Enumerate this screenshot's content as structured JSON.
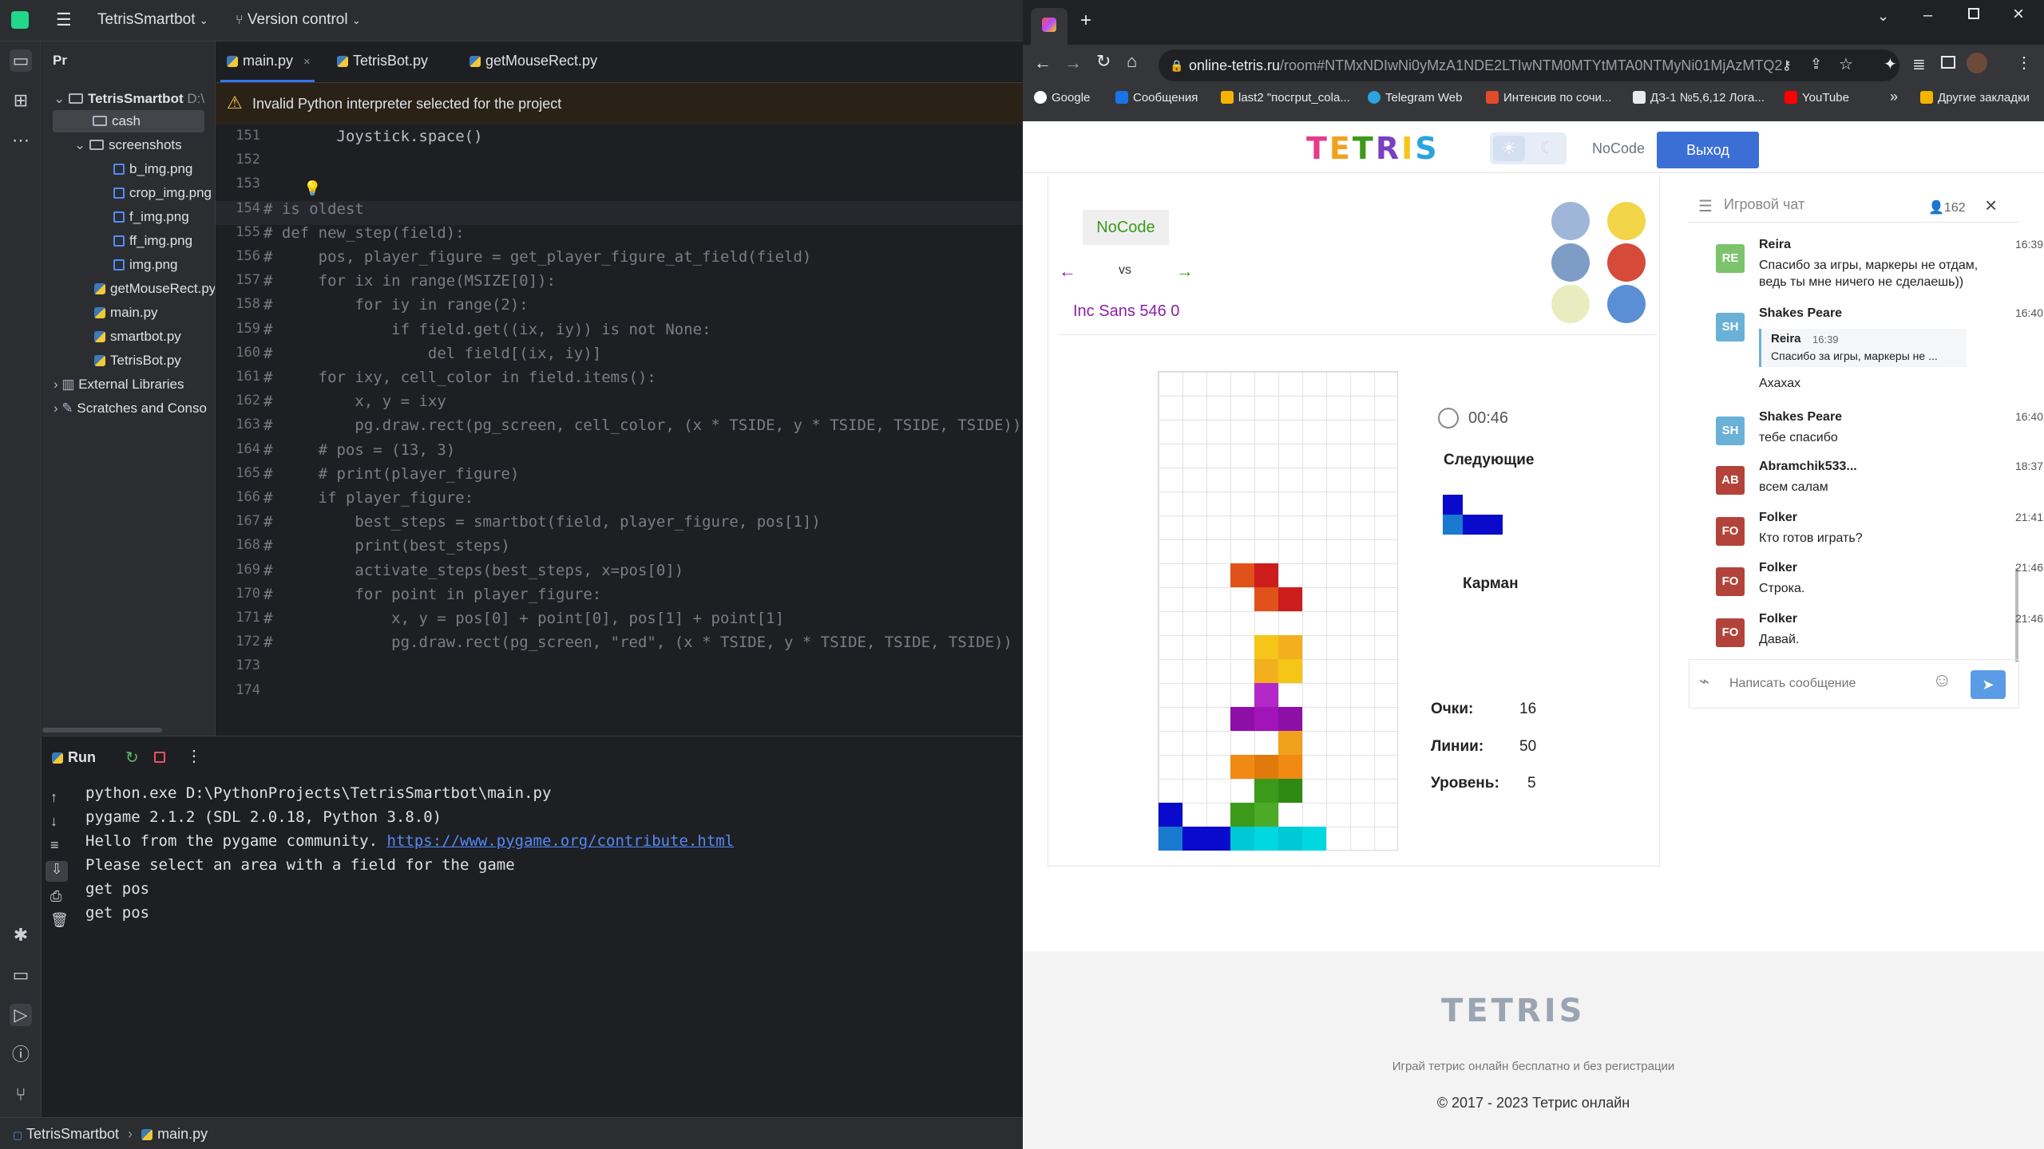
{
  "ide": {
    "project_name": "TetrisSmartbot",
    "version_control": "Version control",
    "panel_label": "Pr",
    "tree": {
      "root": "TetrisSmartbot",
      "root_path": "D:\\",
      "cash": "cash",
      "screenshots": "screenshots",
      "files_png": [
        "b_img.png",
        "crop_img.png",
        "f_img.png",
        "ff_img.png",
        "img.png"
      ],
      "files_py": [
        "getMouseRect.py",
        "main.py",
        "smartbot.py",
        "TetrisBot.py"
      ],
      "external": "External Libraries",
      "scratches": "Scratches and Conso"
    },
    "tabs": [
      "main.py",
      "TetrisBot.py",
      "getMouseRect.py"
    ],
    "warning": "Invalid Python interpreter selected for the project",
    "code_lines": [
      {
        "n": "151",
        "t": "        Joystick.space()"
      },
      {
        "n": "152",
        "t": ""
      },
      {
        "n": "153",
        "t": ""
      },
      {
        "n": "154",
        "t": "# is oldest"
      },
      {
        "n": "155",
        "t": "# def new_step(field):"
      },
      {
        "n": "156",
        "t": "#     pos, player_figure = get_player_figure_at_field(field)"
      },
      {
        "n": "157",
        "t": "#     for ix in range(MSIZE[0]):"
      },
      {
        "n": "158",
        "t": "#         for iy in range(2):"
      },
      {
        "n": "159",
        "t": "#             if field.get((ix, iy)) is not None:"
      },
      {
        "n": "160",
        "t": "#                 del field[(ix, iy)]"
      },
      {
        "n": "161",
        "t": "#     for ixy, cell_color in field.items():"
      },
      {
        "n": "162",
        "t": "#         x, y = ixy"
      },
      {
        "n": "163",
        "t": "#         pg.draw.rect(pg_screen, cell_color, (x * TSIDE, y * TSIDE, TSIDE, TSIDE))"
      },
      {
        "n": "164",
        "t": "#     # pos = (13, 3)"
      },
      {
        "n": "165",
        "t": "#     # print(player_figure)"
      },
      {
        "n": "166",
        "t": "#     if player_figure:"
      },
      {
        "n": "167",
        "t": "#         best_steps = smartbot(field, player_figure, pos[1])"
      },
      {
        "n": "168",
        "t": "#         print(best_steps)"
      },
      {
        "n": "169",
        "t": "#         activate_steps(best_steps, x=pos[0])"
      },
      {
        "n": "170",
        "t": "#         for point in player_figure:"
      },
      {
        "n": "171",
        "t": "#             x, y = pos[0] + point[0], pos[1] + point[1]"
      },
      {
        "n": "172",
        "t": "#             pg.draw.rect(pg_screen, \"red\", (x * TSIDE, y * TSIDE, TSIDE, TSIDE))"
      },
      {
        "n": "173",
        "t": ""
      },
      {
        "n": "174",
        "t": ""
      }
    ],
    "run_tab": "Run",
    "run_output": [
      "python.exe D:\\PythonProjects\\TetrisSmartbot\\main.py",
      "pygame 2.1.2 (SDL 2.0.18, Python 3.8.0)",
      "Hello from the pygame community. ",
      "Please select an area with a field for the game",
      "get pos",
      "get pos"
    ],
    "run_link": "https://www.pygame.org/contribute.html",
    "breadcrumb": [
      "TetrisSmartbot",
      "main.py"
    ]
  },
  "browser": {
    "url_host": "online-tetris.ru",
    "url_path": "/room#NTMxNDIwNi0yMzA1NDE2LTIwNTM0MTYtMTA0NTMyNi01MjAzMTQ2",
    "bookmarks": [
      "Google",
      "Сообщения",
      "last2 \"посгрut_cola...",
      "Telegram Web",
      "Интенсив по сочи...",
      "ДЗ-1 №5,6,12 Лога...",
      "YouTube",
      "Другие закладки"
    ],
    "bookmarks_more": "»",
    "site": {
      "logo": "TETRIS",
      "user": "NoCode",
      "logout": "Выход",
      "player_self": "NoCode",
      "vs": "vs",
      "opponent": "Inc Sans 546 0",
      "timer": "00:46",
      "next_label": "Следующие",
      "hold_label": "Карман",
      "score_label": "Очки:",
      "score": "16",
      "lines_label": "Линии:",
      "lines": "50",
      "level_label": "Уровень:",
      "level": "5"
    },
    "chat": {
      "title": "Игровой чат",
      "online": "162",
      "messages": [
        {
          "initials": "RE",
          "name": "Reira",
          "time": "16:39",
          "text": "Спасибо за игры, маркеры не отдам, ведь ты мне ничего не сделаешь))",
          "color": "#7cc36b"
        },
        {
          "initials": "SH",
          "name": "Shakes Peare",
          "time": "16:40",
          "quote_name": "Reira",
          "quote_time": "16:39",
          "quote_text": "Спасибо за игры, маркеры не ...",
          "text": "Ахахах",
          "color": "#6ab1d8"
        },
        {
          "initials": "SH",
          "name": "Shakes Peare",
          "time": "16:40",
          "text": "тебе спасибо",
          "color": "#6ab1d8"
        },
        {
          "initials": "AB",
          "name": "Abramchik533...",
          "time": "18:37",
          "text": "всем салам",
          "color": "#b3433a"
        },
        {
          "initials": "FO",
          "name": "Folker",
          "time": "21:41",
          "text": "Кто готов играть?",
          "color": "#b3433a"
        },
        {
          "initials": "FO",
          "name": "Folker",
          "time": "21:46",
          "text": "Строка.",
          "color": "#b3433a"
        },
        {
          "initials": "FO",
          "name": "Folker",
          "time": "21:46",
          "text": "Давай.",
          "color": "#b3433a"
        }
      ],
      "input_placeholder": "Написать сообщение"
    },
    "footer": {
      "tagline": "Играй тетрис онлайн бесплатно и без регистрации",
      "copyright": "© 2017 - 2023 Тетрис онлайн"
    }
  },
  "board": {
    "cols": 10,
    "rows": 20,
    "cells": [
      {
        "c": 3,
        "r": 8,
        "color": "#e0521a"
      },
      {
        "c": 4,
        "r": 8,
        "color": "#cc1c1c"
      },
      {
        "c": 4,
        "r": 9,
        "color": "#e0521a"
      },
      {
        "c": 5,
        "r": 9,
        "color": "#cc1c1c"
      },
      {
        "c": 4,
        "r": 11,
        "color": "#f5c518"
      },
      {
        "c": 5,
        "r": 11,
        "color": "#f2b01e"
      },
      {
        "c": 4,
        "r": 12,
        "color": "#f2b01e"
      },
      {
        "c": 5,
        "r": 12,
        "color": "#f5c518"
      },
      {
        "c": 4,
        "r": 13,
        "color": "#b228c8"
      },
      {
        "c": 3,
        "r": 14,
        "color": "#8e0fa8"
      },
      {
        "c": 4,
        "r": 14,
        "color": "#a014b8"
      },
      {
        "c": 5,
        "r": 14,
        "color": "#8e0fa8"
      },
      {
        "c": 5,
        "r": 15,
        "color": "#f2a11e"
      },
      {
        "c": 3,
        "r": 16,
        "color": "#f08a12"
      },
      {
        "c": 4,
        "r": 16,
        "color": "#e07a0a"
      },
      {
        "c": 5,
        "r": 16,
        "color": "#f08a12"
      },
      {
        "c": 4,
        "r": 17,
        "color": "#3c9a1a"
      },
      {
        "c": 5,
        "r": 17,
        "color": "#2e8a12"
      },
      {
        "c": 0,
        "r": 18,
        "color": "#0a0acc"
      },
      {
        "c": 3,
        "r": 18,
        "color": "#3c9a1a"
      },
      {
        "c": 4,
        "r": 18,
        "color": "#4caa28"
      },
      {
        "c": 0,
        "r": 19,
        "color": "#1a7ad0"
      },
      {
        "c": 1,
        "r": 19,
        "color": "#0a0acc"
      },
      {
        "c": 2,
        "r": 19,
        "color": "#0a0acc"
      },
      {
        "c": 3,
        "r": 19,
        "color": "#00c8d4"
      },
      {
        "c": 4,
        "r": 19,
        "color": "#00d8e0"
      },
      {
        "c": 5,
        "r": 19,
        "color": "#00c8d4"
      },
      {
        "c": 6,
        "r": 19,
        "color": "#00d8e0"
      }
    ],
    "next_piece": [
      {
        "c": 0,
        "r": 0,
        "color": "#0a0acc"
      },
      {
        "c": 0,
        "r": 1,
        "color": "#1a7ad0"
      },
      {
        "c": 1,
        "r": 1,
        "color": "#0a0acc"
      },
      {
        "c": 2,
        "r": 1,
        "color": "#0a0acc"
      }
    ]
  }
}
